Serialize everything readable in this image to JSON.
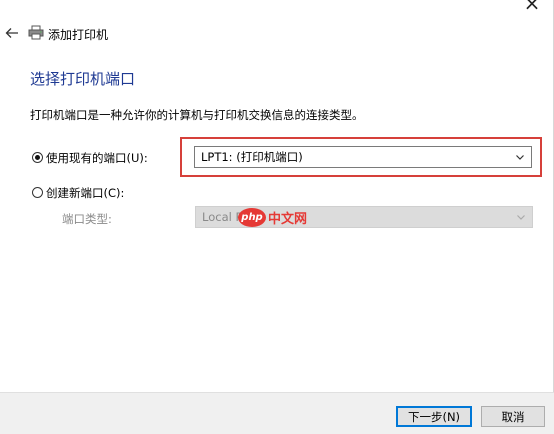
{
  "window": {
    "close_label": "×"
  },
  "header": {
    "back_icon": "back-arrow-icon",
    "printer_icon": "printer-icon",
    "title": "添加打印机"
  },
  "page": {
    "title": "选择打印机端口",
    "description": "打印机端口是一种允许你的计算机与打印机交换信息的连接类型。"
  },
  "options": {
    "use_existing": {
      "label": "使用现有的端口(U):",
      "checked": true,
      "selected_value": "LPT1: (打印机端口)"
    },
    "create_new": {
      "label": "创建新端口(C):",
      "checked": false,
      "port_type_label": "端口类型:",
      "port_type_value": "Local P"
    }
  },
  "watermark": {
    "logo": "php",
    "text": "中文网"
  },
  "footer": {
    "next_label": "下一步(N)",
    "cancel_label": "取消"
  },
  "colors": {
    "title": "#1f3a93",
    "highlight": "#d6403a",
    "primary_button_border": "#0078d7",
    "watermark": "#e53935"
  }
}
